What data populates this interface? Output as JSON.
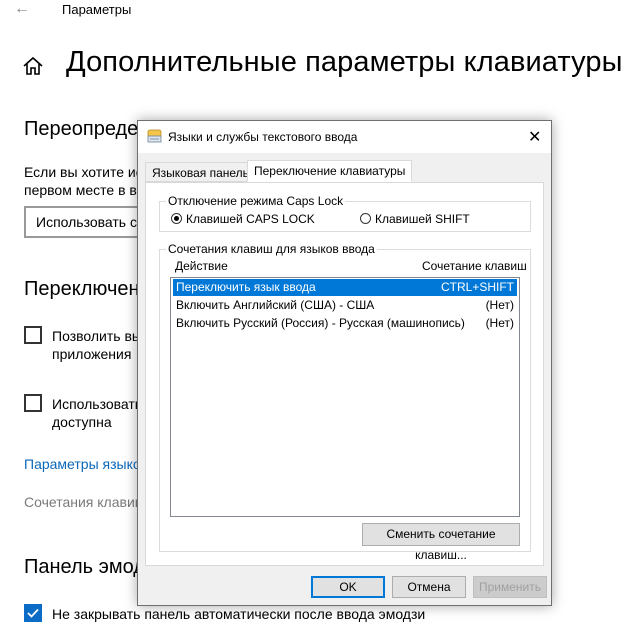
{
  "settings": {
    "window_title": "Параметры",
    "page_title": "Дополнительные параметры клавиатуры",
    "section_override": "Переопреде",
    "override_text_1": "Если вы хотите ис",
    "override_text_2": "первом месте в в",
    "select_value": "Использовать с",
    "section_switching": "Переключен",
    "check1_line1": "Позволить вы",
    "check1_line2": "приложения",
    "check2_line1": "Использовать",
    "check2_line2": "доступна",
    "link_language_bar": "Параметры языко",
    "shortcuts_text": "Сочетания клавиш",
    "section_emoji": "Панель эмод",
    "emoji_check_label": "Не закрывать панель автоматически после ввода эмодзи"
  },
  "dialog": {
    "title": "Языки и службы текстового ввода",
    "close": "✕",
    "tabs": [
      {
        "label": "Языковая панель",
        "active": false
      },
      {
        "label": "Переключение клавиатуры",
        "active": true
      }
    ],
    "capslock_group": {
      "legend": "Отключение режима Caps Lock",
      "options": [
        {
          "label": "Клавишей CAPS LOCK",
          "selected": true
        },
        {
          "label": "Клавишей SHIFT",
          "selected": false
        }
      ]
    },
    "hotkeys_group": {
      "legend": "Сочетания клавиш для языков ввода",
      "col_action": "Действие",
      "col_shortcut": "Сочетание клавиш",
      "rows": [
        {
          "action": "Переключить язык ввода",
          "shortcut": "CTRL+SHIFT",
          "selected": true
        },
        {
          "action": "Включить Английский (США) - США",
          "shortcut": "(Нет)",
          "selected": false
        },
        {
          "action": "Включить Русский (Россия) - Русская (машинопись)",
          "shortcut": "(Нет)",
          "selected": false
        }
      ],
      "change_button": "Сменить сочетание клавиш..."
    },
    "buttons": {
      "ok": "OK",
      "cancel": "Отмена",
      "apply": "Применить"
    }
  },
  "colors": {
    "accent": "#0078d7",
    "link": "#0a67b9",
    "checkbox_checked": "#0a6cc4"
  }
}
